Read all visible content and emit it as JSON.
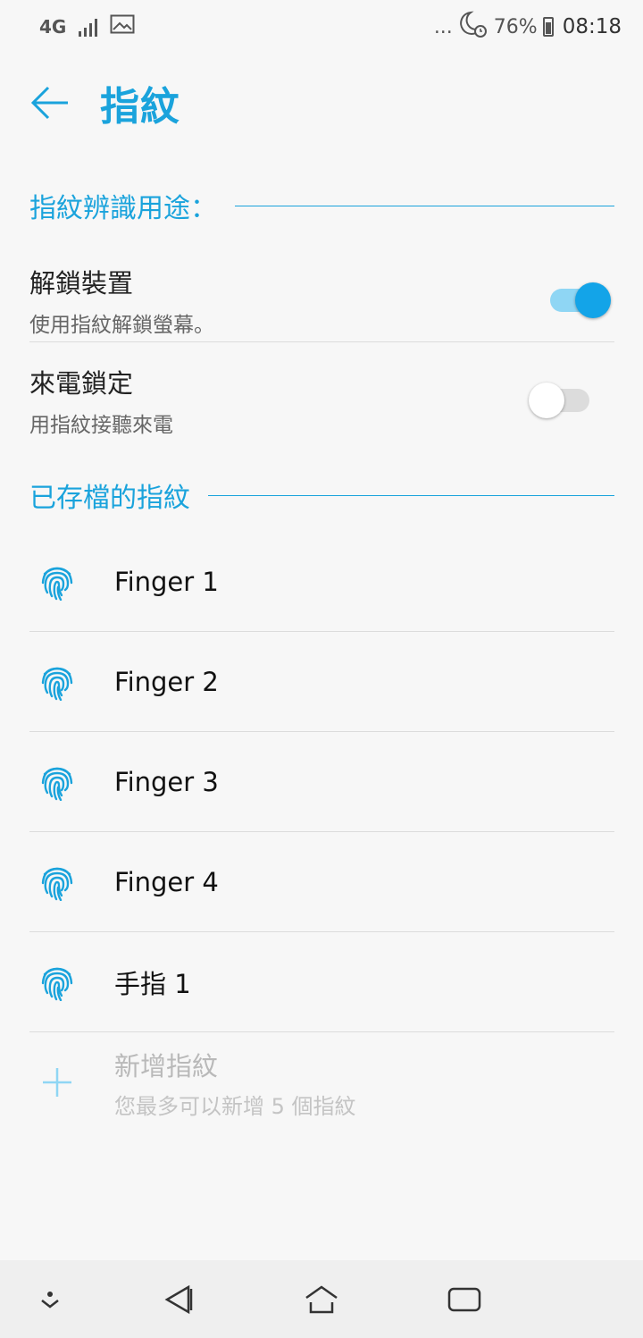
{
  "status_bar": {
    "network": "4G",
    "battery": "76%",
    "time": "08:18",
    "more": "..."
  },
  "header": {
    "title": "指紋"
  },
  "section_usage": {
    "title": "指紋辨識用途："
  },
  "prefs": [
    {
      "title": "解鎖裝置",
      "subtitle": "使用指紋解鎖螢幕。",
      "enabled": true
    },
    {
      "title": "來電鎖定",
      "subtitle": "用指紋接聽來電",
      "enabled": false
    }
  ],
  "section_saved": {
    "title": "已存檔的指紋"
  },
  "fingerprints": [
    {
      "label": "Finger 1"
    },
    {
      "label": "Finger 2"
    },
    {
      "label": "Finger 3"
    },
    {
      "label": "Finger 4"
    },
    {
      "label": "手指 1"
    }
  ],
  "add": {
    "title": "新增指紋",
    "subtitle": "您最多可以新增 5 個指紋"
  },
  "colors": {
    "accent": "#1aa3dc",
    "switch_on": "#13a4e8"
  }
}
